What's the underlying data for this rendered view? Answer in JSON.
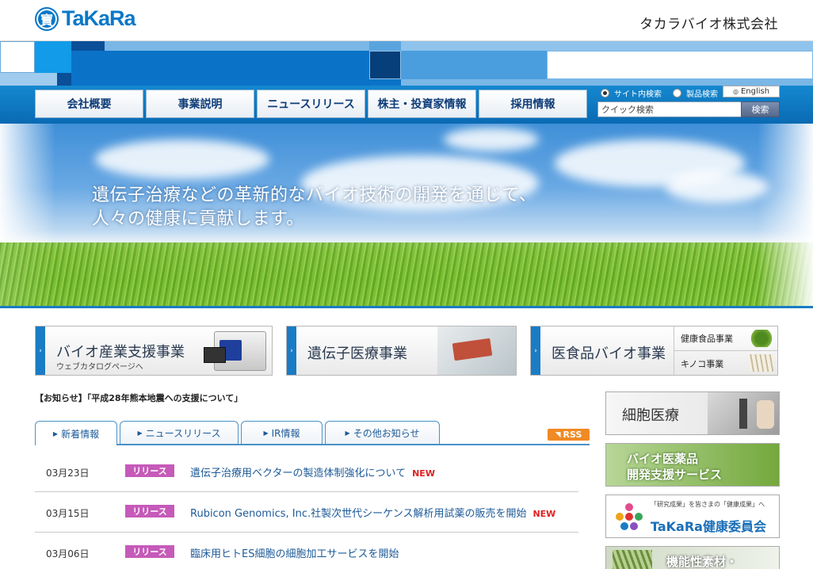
{
  "header": {
    "logo_text": "TaKaRa",
    "logo_mark": "寶",
    "company_name": "タカラバイオ株式会社"
  },
  "nav": {
    "items": [
      {
        "label": "会社概要"
      },
      {
        "label": "事業説明"
      },
      {
        "label": "ニュースリリース"
      },
      {
        "label": "株主・投資家情報"
      },
      {
        "label": "採用情報"
      }
    ]
  },
  "search": {
    "radio_site": "サイト内検索",
    "radio_product": "製品検索",
    "radio_selected": "サイト内検索",
    "english_label": "English",
    "placeholder": "クイック検索",
    "value": "クイック検索",
    "button_label": "検索"
  },
  "hero": {
    "line1": "遺伝子治療などの革新的なバイオ技術の開発を通じて、",
    "line2": "人々の健康に貢献します。"
  },
  "business": [
    {
      "title": "バイオ産業支援事業",
      "sub": "ウェブカタログページへ"
    },
    {
      "title": "遺伝子医療事業"
    },
    {
      "title": "医食品バイオ事業",
      "links": [
        "健康食品事業",
        "キノコ事業"
      ]
    }
  ],
  "notice": {
    "text": "【お知らせ】「平成28年熊本地震への支援について」"
  },
  "tabs": [
    {
      "label": "新着情報",
      "active": true
    },
    {
      "label": "ニュースリリース",
      "active": false
    },
    {
      "label": "IR情報",
      "active": false
    },
    {
      "label": "その他お知らせ",
      "active": false
    }
  ],
  "rss_label": "RSS",
  "news": [
    {
      "date": "03月23日",
      "badge": "リリース",
      "text": "遺伝子治療用ベクターの製造体制強化について",
      "new_label": "NEW"
    },
    {
      "date": "03月15日",
      "badge": "リリース",
      "text": "Rubicon Genomics, Inc.社製次世代シーケンス解析用試薬の販売を開始",
      "new_label": "NEW"
    },
    {
      "date": "03月06日",
      "badge": "リリース",
      "text": "臨床用ヒトES細胞の細胞加工サービスを開始",
      "new_label": ""
    }
  ],
  "right_banners": [
    {
      "text": "細胞医療"
    },
    {
      "line1": "バイオ医薬品",
      "line2": "開発支援サービス"
    },
    {
      "caption": "「研究成果」を皆さまの「健康成果」へ",
      "text": "TaKaRa健康委員会"
    },
    {
      "text": "機能性素材・"
    }
  ],
  "colors": {
    "brand_blue": "#0a78c8",
    "nav_blue": "#0a6ab3",
    "badge_purple": "#c65ab9",
    "new_red": "#e02020",
    "rss_orange": "#f08a24",
    "link_blue": "#1d5a98"
  },
  "icons": {
    "logo": "takara-logo-icon",
    "english": "circle-arrow-icon",
    "tab_arrow": "chevron-right-icon",
    "rss": "rss-icon"
  }
}
